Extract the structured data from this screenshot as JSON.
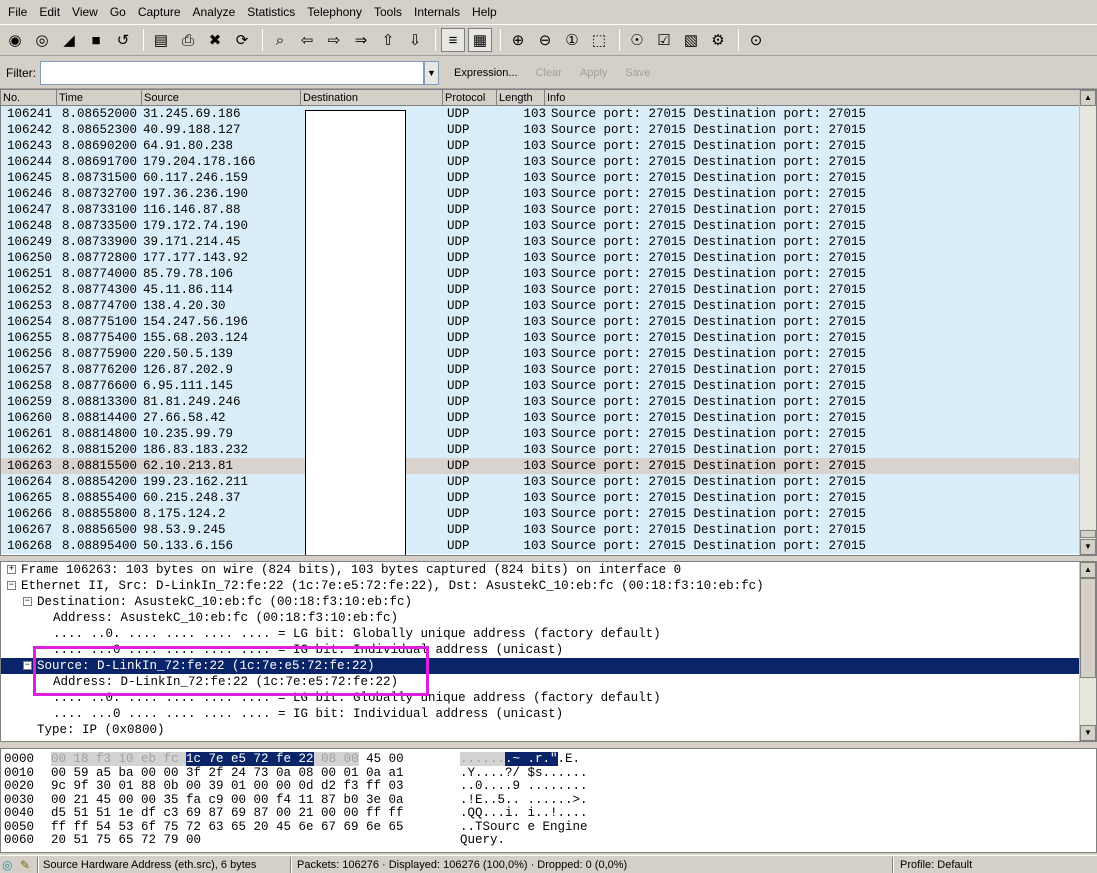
{
  "menu": [
    "File",
    "Edit",
    "View",
    "Go",
    "Capture",
    "Analyze",
    "Statistics",
    "Telephony",
    "Tools",
    "Internals",
    "Help"
  ],
  "toolbar": {
    "icons": [
      "list-interfaces-icon",
      "capture-options-icon",
      "start-capture-icon",
      "stop-capture-icon",
      "restart-capture-icon",
      "open-file-icon",
      "save-file-icon",
      "close-file-icon",
      "reload-icon",
      "find-packet-icon",
      "go-back-icon",
      "go-forward-icon",
      "go-to-packet-icon",
      "go-first-icon",
      "go-last-icon",
      "colorize-icon",
      "auto-scroll-icon",
      "zoom-in-icon",
      "zoom-out-icon",
      "zoom-normal-icon",
      "resize-columns-icon",
      "capture-filters-icon",
      "display-filters-icon",
      "coloring-rules-icon",
      "preferences-icon",
      "help-icon"
    ],
    "glyphs": [
      "◉",
      "◎",
      "◢",
      "■",
      "↺",
      "▤",
      "⎙",
      "✖",
      "⟳",
      "⌕",
      "⇦",
      "⇨",
      "⇒",
      "⇧",
      "⇩",
      "≡",
      "▦",
      "⊕",
      "⊖",
      "①",
      "⬚",
      "☉",
      "☑",
      "▧",
      "⚙",
      "⊙"
    ]
  },
  "filter": {
    "label": "Filter:",
    "value": "",
    "expression": "Expression...",
    "clear": "Clear",
    "apply": "Apply",
    "save": "Save"
  },
  "packet_list": {
    "columns": [
      "No.",
      "Time",
      "Source",
      "Destination",
      "Protocol",
      "Length",
      "Info"
    ],
    "selected_no": "106263",
    "rows": [
      [
        "106241",
        "8.08652000",
        "31.245.69.186",
        "UDP",
        "103",
        "Source port: 27015   Destination port: 27015"
      ],
      [
        "106242",
        "8.08652300",
        "40.99.188.127",
        "UDP",
        "103",
        "Source port: 27015   Destination port: 27015"
      ],
      [
        "106243",
        "8.08690200",
        "64.91.80.238",
        "UDP",
        "103",
        "Source port: 27015   Destination port: 27015"
      ],
      [
        "106244",
        "8.08691700",
        "179.204.178.166",
        "UDP",
        "103",
        "Source port: 27015   Destination port: 27015"
      ],
      [
        "106245",
        "8.08731500",
        "60.117.246.159",
        "UDP",
        "103",
        "Source port: 27015   Destination port: 27015"
      ],
      [
        "106246",
        "8.08732700",
        "197.36.236.190",
        "UDP",
        "103",
        "Source port: 27015   Destination port: 27015"
      ],
      [
        "106247",
        "8.08733100",
        "116.146.87.88",
        "UDP",
        "103",
        "Source port: 27015   Destination port: 27015"
      ],
      [
        "106248",
        "8.08733500",
        "179.172.74.190",
        "UDP",
        "103",
        "Source port: 27015   Destination port: 27015"
      ],
      [
        "106249",
        "8.08733900",
        "39.171.214.45",
        "UDP",
        "103",
        "Source port: 27015   Destination port: 27015"
      ],
      [
        "106250",
        "8.08772800",
        "177.177.143.92",
        "UDP",
        "103",
        "Source port: 27015   Destination port: 27015"
      ],
      [
        "106251",
        "8.08774000",
        "85.79.78.106",
        "UDP",
        "103",
        "Source port: 27015   Destination port: 27015"
      ],
      [
        "106252",
        "8.08774300",
        "45.11.86.114",
        "UDP",
        "103",
        "Source port: 27015   Destination port: 27015"
      ],
      [
        "106253",
        "8.08774700",
        "138.4.20.30",
        "UDP",
        "103",
        "Source port: 27015   Destination port: 27015"
      ],
      [
        "106254",
        "8.08775100",
        "154.247.56.196",
        "UDP",
        "103",
        "Source port: 27015   Destination port: 27015"
      ],
      [
        "106255",
        "8.08775400",
        "155.68.203.124",
        "UDP",
        "103",
        "Source port: 27015   Destination port: 27015"
      ],
      [
        "106256",
        "8.08775900",
        "220.50.5.139",
        "UDP",
        "103",
        "Source port: 27015   Destination port: 27015"
      ],
      [
        "106257",
        "8.08776200",
        "126.87.202.9",
        "UDP",
        "103",
        "Source port: 27015   Destination port: 27015"
      ],
      [
        "106258",
        "8.08776600",
        "6.95.111.145",
        "UDP",
        "103",
        "Source port: 27015   Destination port: 27015"
      ],
      [
        "106259",
        "8.08813300",
        "81.81.249.246",
        "UDP",
        "103",
        "Source port: 27015   Destination port: 27015"
      ],
      [
        "106260",
        "8.08814400",
        "27.66.58.42",
        "UDP",
        "103",
        "Source port: 27015   Destination port: 27015"
      ],
      [
        "106261",
        "8.08814800",
        "10.235.99.79",
        "UDP",
        "103",
        "Source port: 27015   Destination port: 27015"
      ],
      [
        "106262",
        "8.08815200",
        "186.83.183.232",
        "UDP",
        "103",
        "Source port: 27015   Destination port: 27015"
      ],
      [
        "106263",
        "8.08815500",
        "62.10.213.81",
        "UDP",
        "103",
        "Source port: 27015   Destination port: 27015"
      ],
      [
        "106264",
        "8.08854200",
        "199.23.162.211",
        "UDP",
        "103",
        "Source port: 27015   Destination port: 27015"
      ],
      [
        "106265",
        "8.08855400",
        "60.215.248.37",
        "UDP",
        "103",
        "Source port: 27015   Destination port: 27015"
      ],
      [
        "106266",
        "8.08855800",
        "8.175.124.2",
        "UDP",
        "103",
        "Source port: 27015   Destination port: 27015"
      ],
      [
        "106267",
        "8.08856500",
        "98.53.9.245",
        "UDP",
        "103",
        "Source port: 27015   Destination port: 27015"
      ],
      [
        "106268",
        "8.08895400",
        "50.133.6.156",
        "UDP",
        "103",
        "Source port: 27015   Destination port: 27015"
      ]
    ]
  },
  "details": [
    {
      "toggle": "+",
      "indent": 0,
      "text": "Frame 106263: 103 bytes on wire (824 bits), 103 bytes captured (824 bits) on interface 0"
    },
    {
      "toggle": "−",
      "indent": 0,
      "text": "Ethernet II, Src: D-LinkIn_72:fe:22 (1c:7e:e5:72:fe:22), Dst: AsustekC_10:eb:fc (00:18:f3:10:eb:fc)"
    },
    {
      "toggle": "−",
      "indent": 1,
      "text": "Destination: AsustekC_10:eb:fc (00:18:f3:10:eb:fc)"
    },
    {
      "toggle": "",
      "indent": 2,
      "text": "Address: AsustekC_10:eb:fc (00:18:f3:10:eb:fc)"
    },
    {
      "toggle": "",
      "indent": 2,
      "text": ".... ..0. .... .... .... .... = LG bit: Globally unique address (factory default)"
    },
    {
      "toggle": "",
      "indent": 2,
      "text": ".... ...0 .... .... .... .... = IG bit: Individual address (unicast)"
    },
    {
      "toggle": "−",
      "indent": 1,
      "text": "Source: D-LinkIn_72:fe:22 (1c:7e:e5:72:fe:22)",
      "selected": true
    },
    {
      "toggle": "",
      "indent": 2,
      "text": "Address: D-LinkIn_72:fe:22 (1c:7e:e5:72:fe:22)"
    },
    {
      "toggle": "",
      "indent": 2,
      "text": ".... ..0. .... .... .... .... = LG bit: Globally unique address (factory default)"
    },
    {
      "toggle": "",
      "indent": 2,
      "text": ".... ...0 .... .... .... .... = IG bit: Individual address (unicast)"
    },
    {
      "toggle": "",
      "indent": 1,
      "text": "Type: IP (0x0800)"
    }
  ],
  "hex": [
    {
      "offset": "0000",
      "parts": [
        [
          "d",
          "00 18 f3 10 eb fc "
        ],
        [
          "h",
          "1c 7e  e5 72 fe 22"
        ],
        [
          "d",
          " 08 00"
        ],
        [
          "n",
          " 45 00"
        ]
      ],
      "ascii": [
        [
          "d",
          "......"
        ],
        [
          "h",
          ".~ .r.\""
        ],
        [
          "n",
          ".E."
        ]
      ]
    },
    {
      "offset": "0010",
      "parts": [
        [
          "n",
          "00 59 a5 ba 00 00 3f 2f  24 73 0a 08 00 01 0a a1"
        ]
      ],
      "ascii": [
        [
          "n",
          ".Y....?/ $s......"
        ]
      ]
    },
    {
      "offset": "0020",
      "parts": [
        [
          "n",
          "9c 9f 30 01 88 0b 00 39  01 00 00 0d d2 f3 ff 03"
        ]
      ],
      "ascii": [
        [
          "n",
          "..0....9 ........"
        ]
      ]
    },
    {
      "offset": "0030",
      "parts": [
        [
          "n",
          "00 21 45 00 00 35 fa c9  00 00 f4 11 87 b0 3e 0a"
        ]
      ],
      "ascii": [
        [
          "n",
          ".!E..5.. ......>."
        ]
      ]
    },
    {
      "offset": "0040",
      "parts": [
        [
          "n",
          "d5 51 51 1e df c3 69 87  69 87 00 21 00 00 ff ff"
        ]
      ],
      "ascii": [
        [
          "n",
          ".QQ...i. i..!...."
        ]
      ]
    },
    {
      "offset": "0050",
      "parts": [
        [
          "n",
          "ff ff 54 53 6f 75 72 63  65 20 45 6e 67 69 6e 65"
        ]
      ],
      "ascii": [
        [
          "n",
          "..TSourc e Engine"
        ]
      ]
    },
    {
      "offset": "0060",
      "parts": [
        [
          "n",
          "20 51 75 65 72 79 00"
        ]
      ],
      "ascii": [
        [
          "n",
          " Query."
        ]
      ]
    }
  ],
  "status": {
    "field": "Source Hardware Address (eth.src), 6 bytes",
    "packets": "Packets: 106276 · Displayed: 106276 (100,0%) · Dropped: 0 (0,0%)",
    "profile": "Profile: Default"
  }
}
